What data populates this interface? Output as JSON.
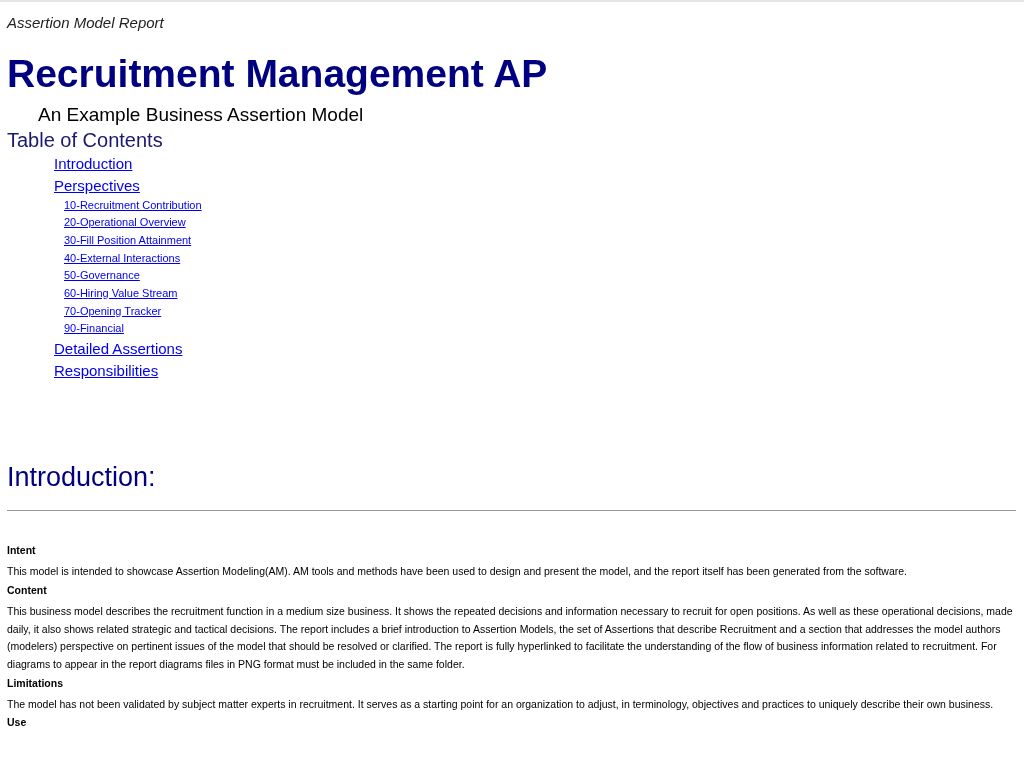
{
  "report_label": "Assertion Model Report",
  "title": "Recruitment Management AP",
  "subtitle": "An Example Business Assertion Model",
  "toc": {
    "heading": "Table of Contents",
    "items": [
      {
        "label": "Introduction"
      },
      {
        "label": "Perspectives",
        "children": [
          {
            "label": "10-Recruitment Contribution"
          },
          {
            "label": "20-Operational Overview"
          },
          {
            "label": "30-Fill Position Attainment"
          },
          {
            "label": "40-External Interactions"
          },
          {
            "label": "50-Governance"
          },
          {
            "label": "60-Hiring Value Stream"
          },
          {
            "label": "70-Opening Tracker"
          },
          {
            "label": "90-Financial"
          }
        ]
      },
      {
        "label": "Detailed Assertions"
      },
      {
        "label": "Responsibilities"
      }
    ]
  },
  "introduction": {
    "heading": "Introduction:",
    "sections": [
      {
        "heading": "Intent",
        "text": "This model is intended to showcase Assertion Modeling(AM). AM tools and methods have been used to design and present the model, and the report itself has been generated from the software."
      },
      {
        "heading": "Content",
        "text": "This business model describes the recruitment function in a medium size business. It shows the repeated decisions and information necessary to recruit for open positions. As well as these operational decisions, made daily, it also shows related strategic and tactical decisions. The report includes a brief introduction to Assertion Models, the set of Assertions that describe Recruitment and a section that addresses the model authors (modelers) perspective on pertinent issues of the model that should be resolved or clarified. The report is fully hyperlinked to facilitate the understanding of the flow of business information related to recruitment. For diagrams to appear in the report diagrams files in PNG format must be included in the same folder."
      },
      {
        "heading": "Limitations",
        "text": "The model has not been validated by subject matter experts in recruitment. It serves as a starting point for an organization to adjust, in terminology, objectives and practices to uniquely describe their own business."
      },
      {
        "heading": "Use"
      }
    ]
  }
}
